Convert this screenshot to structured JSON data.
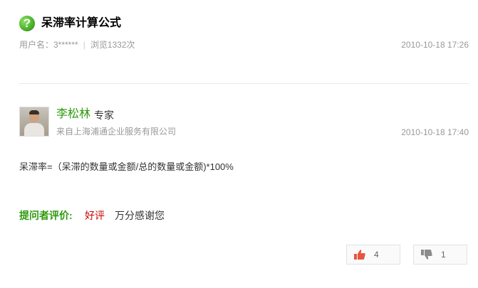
{
  "question": {
    "icon": "question-mark-icon",
    "title": "呆滞率计算公式",
    "user_label": "用户名：3******",
    "views": "浏览1332次",
    "time": "2010-10-18 17:26"
  },
  "answer": {
    "name": "李松林",
    "role": "专家",
    "org": "来自上海浦通企业服务有限公司",
    "time": "2010-10-18 17:40",
    "content": "呆滞率=（呆滞的数量或金额/总的数量或金额)*100%",
    "evaluation_label": "提问者评价:",
    "evaluation_value": "好评",
    "evaluation_comment": "万分感谢您"
  },
  "votes": {
    "up_icon": "thumbs-up-icon",
    "up_count": "4",
    "down_icon": "thumbs-down-icon",
    "down_count": "1"
  },
  "colors": {
    "accent_green": "#2d9a0c",
    "positive_red": "#c00000",
    "thumb_up": "#e8553e",
    "thumb_down": "#8c8c8c"
  }
}
